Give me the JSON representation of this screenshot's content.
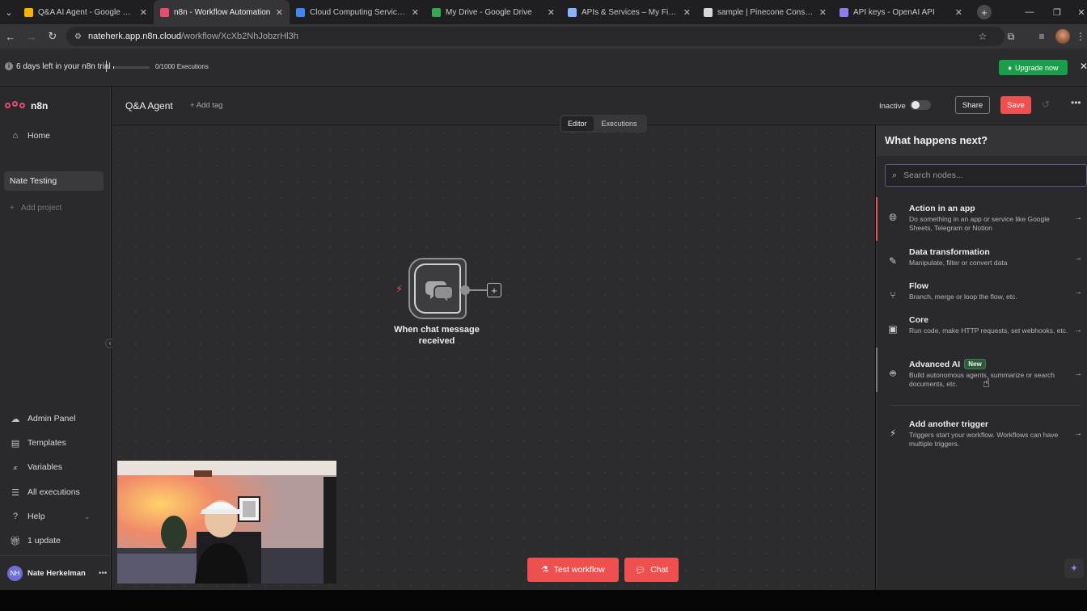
{
  "browser": {
    "tabs": [
      {
        "title": "Q&A AI Agent - Google Slides",
        "color": "#f4b400"
      },
      {
        "title": "n8n - Workflow Automation",
        "color": "#ea4b71"
      },
      {
        "title": "Cloud Computing Services | Go",
        "color": "#4285f4"
      },
      {
        "title": "My Drive - Google Drive",
        "color": "#34a853"
      },
      {
        "title": "APIs & Services – My First Proje",
        "color": "#8ab4f8"
      },
      {
        "title": "sample | Pinecone Console",
        "color": "#d7d7da"
      },
      {
        "title": "API keys - OpenAI API",
        "color": "#8e7cf0"
      }
    ],
    "url_host": "natehерk.app.n8n.cloud",
    "url_path": "/workflow/XcXb2NhJobzrHl3h"
  },
  "trial": {
    "text": "6 days left in your n8n trial",
    "executions": "0/1000 Executions",
    "progress": 0.02,
    "upgrade_label": "Upgrade now"
  },
  "sidebar": {
    "brand": "n8n",
    "home": "Home",
    "project": "Nate Testing",
    "add_project": "Add project",
    "items": [
      {
        "label": "Admin Panel",
        "icon": "cloud-icon"
      },
      {
        "label": "Templates",
        "icon": "templates-icon"
      },
      {
        "label": "Variables",
        "icon": "variables-icon"
      },
      {
        "label": "All executions",
        "icon": "list-icon"
      },
      {
        "label": "Help",
        "icon": "help-icon"
      },
      {
        "label": "1 update",
        "icon": "gift-icon"
      }
    ],
    "user_initials": "NH",
    "user_name": "Nate Herkelman"
  },
  "header": {
    "workflow_name": "Q&A Agent",
    "add_tag": "+ Add tag",
    "status": "Inactive",
    "share": "Share",
    "save": "Save"
  },
  "modes": {
    "editor": "Editor",
    "executions": "Executions"
  },
  "node": {
    "label": "When chat message received"
  },
  "actions": {
    "test": "Test workflow",
    "chat": "Chat"
  },
  "panel": {
    "title": "What happens next?",
    "search_placeholder": "Search nodes...",
    "options": [
      {
        "name": "Action in an app",
        "desc": "Do something in an app or service like Google Sheets, Telegram or Notion",
        "icon": "globe-icon"
      },
      {
        "name": "Data transformation",
        "desc": "Manipulate, filter or convert data",
        "icon": "pencil-icon"
      },
      {
        "name": "Flow",
        "desc": "Branch, merge or loop the flow, etc.",
        "icon": "branch-icon"
      },
      {
        "name": "Core",
        "desc": "Run code, make HTTP requests, set webhooks, etc.",
        "icon": "toolbox-icon"
      },
      {
        "name": "Advanced AI",
        "badge": "New",
        "desc": "Build autonomous agents, summarize or search documents, etc.",
        "icon": "robot-icon"
      },
      {
        "name": "Add another trigger",
        "desc": "Triggers start your workflow. Workflows can have multiple triggers.",
        "icon": "bolt-icon"
      }
    ]
  }
}
